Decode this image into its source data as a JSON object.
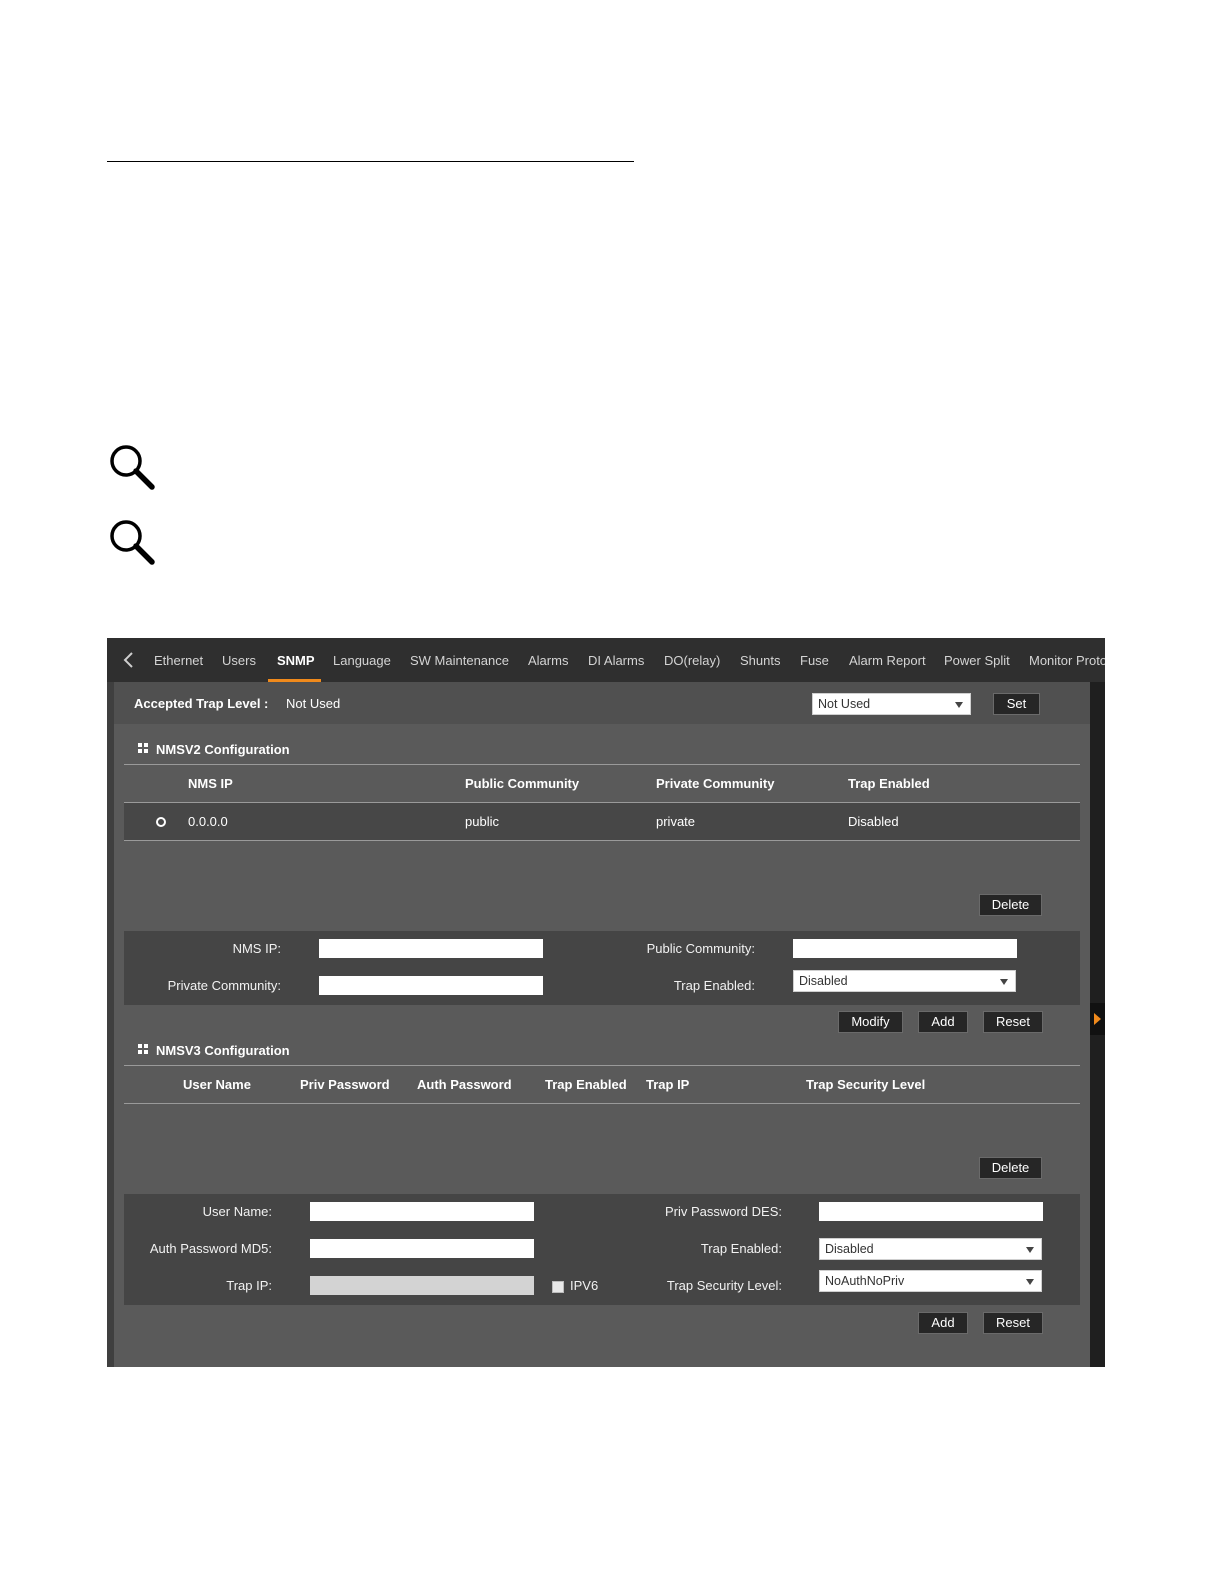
{
  "tabs": {
    "items": [
      "Ethernet",
      "Users",
      "SNMP",
      "Language",
      "SW Maintenance",
      "Alarms",
      "DI Alarms",
      "DO(relay)",
      "Shunts",
      "Fuse",
      "Alarm Report",
      "Power Split",
      "Monitor Proto"
    ],
    "active": "SNMP"
  },
  "trap_level": {
    "label": "Accepted Trap Level :",
    "value": "Not Used",
    "select_value": "Not Used",
    "set_button": "Set"
  },
  "nmsv2": {
    "title": "NMSV2 Configuration",
    "columns": [
      "NMS IP",
      "Public Community",
      "Private Community",
      "Trap Enabled"
    ],
    "rows": [
      {
        "nms_ip": "0.0.0.0",
        "public_community": "public",
        "private_community": "private",
        "trap_enabled": "Disabled"
      }
    ],
    "delete_button": "Delete",
    "form": {
      "nms_ip_label": "NMS IP:",
      "nms_ip_value": "",
      "public_community_label": "Public Community:",
      "public_community_value": "",
      "private_community_label": "Private Community:",
      "private_community_value": "",
      "trap_enabled_label": "Trap Enabled:",
      "trap_enabled_value": "Disabled"
    },
    "buttons": {
      "modify": "Modify",
      "add": "Add",
      "reset": "Reset"
    }
  },
  "nmsv3": {
    "title": "NMSV3 Configuration",
    "columns": [
      "User Name",
      "Priv Password",
      "Auth Password",
      "Trap Enabled",
      "Trap IP",
      "Trap Security Level"
    ],
    "rows": [],
    "delete_button": "Delete",
    "form": {
      "user_name_label": "User Name:",
      "user_name_value": "",
      "priv_password_label": "Priv Password DES:",
      "priv_password_value": "",
      "auth_password_label": "Auth Password MD5:",
      "auth_password_value": "",
      "trap_enabled_label": "Trap Enabled:",
      "trap_enabled_value": "Disabled",
      "trap_ip_label": "Trap IP:",
      "trap_ip_value": "",
      "ipv6_label": "IPV6",
      "ipv6_checked": false,
      "trap_security_label": "Trap Security Level:",
      "trap_security_value": "NoAuthNoPriv"
    },
    "buttons": {
      "add": "Add",
      "reset": "Reset"
    }
  },
  "colors": {
    "accent": "#f08a1c",
    "panel_bg": "#5a5a5a",
    "tabbar_bg": "#2f2f2f",
    "button_bg": "#262626"
  },
  "icons": [
    "magnifier-icon",
    "back-chevron-icon",
    "grid-icon",
    "dropdown-caret-icon",
    "radio-icon",
    "expand-arrow-icon"
  ]
}
